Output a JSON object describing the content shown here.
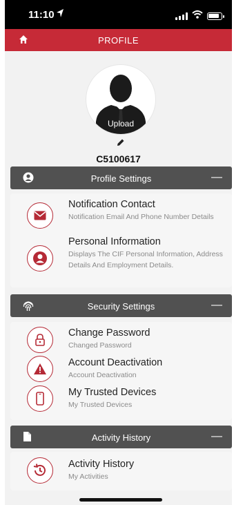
{
  "status_bar": {
    "time": "11:10"
  },
  "appbar": {
    "title": "PROFILE"
  },
  "profile": {
    "upload_label": "Upload",
    "cif_id": "C5100617"
  },
  "sections": [
    {
      "title": "Profile Settings",
      "toggle": "—",
      "items": [
        {
          "title": "Notification Contact",
          "desc": "Notification Email And Phone Number Details",
          "icon": "envelope-icon"
        },
        {
          "title": "Personal Information",
          "desc": "Displays The CIF Personal Information, Address Details And Employment Details.",
          "icon": "user-circle-icon"
        }
      ]
    },
    {
      "title": "Security Settings",
      "toggle": "—",
      "items": [
        {
          "title": "Change Password",
          "desc": "Changed Password",
          "icon": "lock-icon"
        },
        {
          "title": "Account Deactivation",
          "desc": "Account Deactivation",
          "icon": "warning-icon"
        },
        {
          "title": "My Trusted Devices",
          "desc": "My Trusted Devices",
          "icon": "phone-icon"
        }
      ]
    },
    {
      "title": "Activity History",
      "toggle": "—",
      "items": [
        {
          "title": "Activity History",
          "desc": "My Activities",
          "icon": "history-icon"
        }
      ]
    }
  ],
  "colors": {
    "brand": "#c62a37",
    "section_header": "#515151",
    "icon_accent": "#b52a36"
  }
}
